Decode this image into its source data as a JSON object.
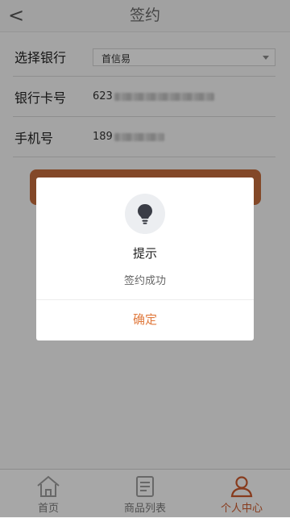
{
  "header": {
    "back_label": "<",
    "title": "签约"
  },
  "form": {
    "bank": {
      "label": "选择银行",
      "selected": "首信易"
    },
    "card": {
      "label": "银行卡号",
      "value_prefix": "623"
    },
    "phone": {
      "label": "手机号",
      "value_prefix": "189"
    }
  },
  "tabbar": {
    "items": [
      {
        "label": "首页",
        "icon": "home-icon"
      },
      {
        "label": "商品列表",
        "icon": "list-icon"
      },
      {
        "label": "个人中心",
        "icon": "user-icon",
        "active": true
      }
    ]
  },
  "dialog": {
    "icon": "lightbulb-icon",
    "title": "提示",
    "message": "签约成功",
    "confirm_label": "确定"
  },
  "colors": {
    "accent": "#c8582c",
    "confirm_text": "#e07a3e",
    "submit_button": "#c26a3c"
  }
}
